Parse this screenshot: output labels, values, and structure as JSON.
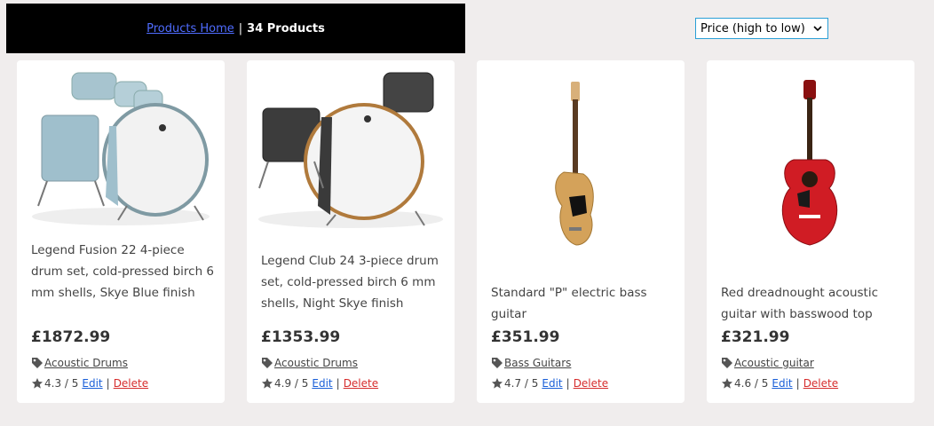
{
  "header": {
    "home_link": "Products Home",
    "separator": "|",
    "count_text": "34 Products"
  },
  "sort": {
    "selected": "Price (high to low)"
  },
  "products": [
    {
      "title": "Legend Fusion 22 4-piece drum set, cold-pressed birch 6 mm shells, Skye Blue finish",
      "price": "£1872.99",
      "category": "Acoustic Drums",
      "rating": "4.3 / 5",
      "image": "drum-kit-blue"
    },
    {
      "title": "Legend Club 24 3-piece drum set, cold-pressed birch 6 mm shells, Night Skye finish",
      "price": "£1353.99",
      "category": "Acoustic Drums",
      "rating": "4.9 / 5",
      "image": "drum-kit-black"
    },
    {
      "title": "Standard \"P\" electric bass guitar",
      "price": "£351.99",
      "category": "Bass Guitars",
      "rating": "4.7 / 5",
      "image": "bass-guitar"
    },
    {
      "title": "Red dreadnought acoustic guitar with basswood top",
      "price": "£321.99",
      "category": "Acoustic guitar",
      "rating": "4.6 / 5",
      "image": "acoustic-guitar-red"
    }
  ],
  "actions": {
    "edit": "Edit",
    "pipe": "|",
    "delete": "Delete"
  }
}
